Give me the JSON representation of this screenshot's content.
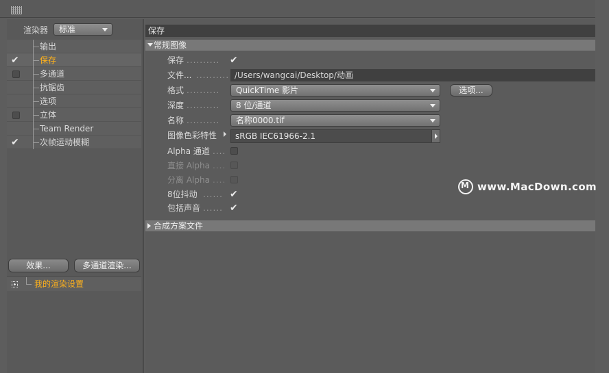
{
  "left_panel": {
    "renderer_label": "渲染器",
    "renderer_value": "标准",
    "tree": [
      {
        "label": "输出",
        "check": "none",
        "selected": false
      },
      {
        "label": "保存",
        "check": "checked",
        "selected": true
      },
      {
        "label": "多通道",
        "check": "box",
        "selected": false
      },
      {
        "label": "抗锯齿",
        "check": "none",
        "selected": false
      },
      {
        "label": "选项",
        "check": "none",
        "selected": false
      },
      {
        "label": "立体",
        "check": "box",
        "selected": false
      },
      {
        "label": "Team Render",
        "check": "none",
        "selected": false
      },
      {
        "label": "次帧运动模糊",
        "check": "checked",
        "selected": false
      }
    ],
    "effects_button": "效果...",
    "multipass_button": "多通道渲染...",
    "render_setting": "我的渲染设置"
  },
  "right_panel": {
    "header": "保存",
    "general_section": "常规图像",
    "save_label": "保存",
    "save_dots": "..........",
    "file_label": "文件...",
    "file_dots": "..........",
    "file_value": "/Users/wangcai/Desktop/动画",
    "format_label": "格式",
    "format_dots": "..........",
    "format_value": "QuickTime 影片",
    "options_button": "选项...",
    "depth_label": "深度",
    "depth_dots": "..........",
    "depth_value": "8 位/通道",
    "name_label": "名称",
    "name_dots": "..........",
    "name_value": "名称0000.tif",
    "profile_label": "图像色彩特性",
    "profile_value": "sRGB IEC61966-2.1",
    "alpha_label": "Alpha 通道",
    "alpha_dots": "....",
    "straight_alpha_label": "直接 Alpha",
    "straight_alpha_dots": "....",
    "separate_alpha_label": "分离 Alpha",
    "separate_alpha_dots": "....",
    "dither_label": "8位抖动",
    "dither_dots": "......",
    "sound_label": "包括声音",
    "sound_dots": "......",
    "comp_section": "合成方案文件"
  },
  "watermark": "www.MacDown.com"
}
